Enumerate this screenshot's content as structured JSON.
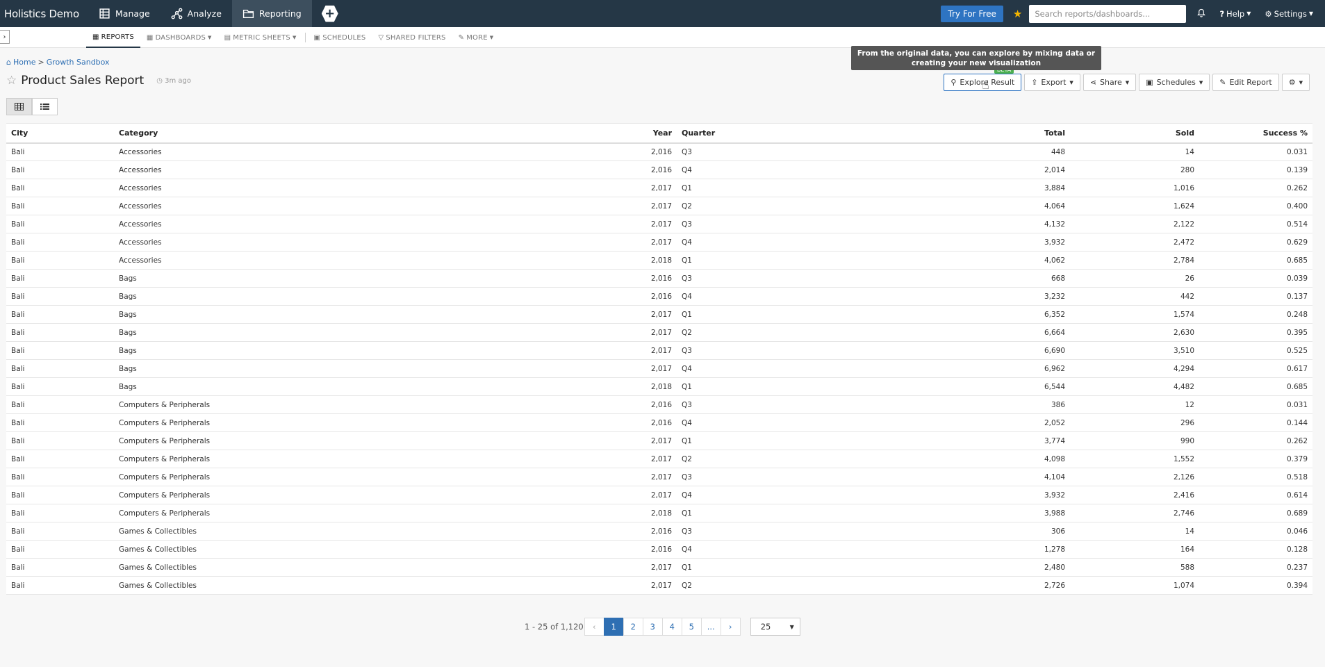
{
  "topbar": {
    "brand": "Holistics Demo",
    "nav": [
      {
        "label": "Manage",
        "icon": "manage-icon"
      },
      {
        "label": "Analyze",
        "icon": "analyze-icon"
      },
      {
        "label": "Reporting",
        "icon": "folder-icon",
        "active": true
      }
    ],
    "try_label": "Try For Free",
    "search_placeholder": "Search reports/dashboards...",
    "help_label": "Help",
    "settings_label": "Settings"
  },
  "subnav": {
    "items": [
      {
        "label": "REPORTS",
        "active": true
      },
      {
        "label": "DASHBOARDS"
      },
      {
        "label": "METRIC SHEETS"
      },
      {
        "label": "SCHEDULES"
      },
      {
        "label": "SHARED FILTERS"
      },
      {
        "label": "MORE"
      }
    ]
  },
  "breadcrumb": {
    "home": "Home",
    "sep": ">",
    "folder": "Growth Sandbox"
  },
  "report": {
    "title": "Product Sales Report",
    "time_ago": "3m ago"
  },
  "tooltip": "From the original data, you can explore by mixing data or creating your new visualization",
  "actions": {
    "explore": "Explore Result",
    "beta": "BETA",
    "export": "Export",
    "share": "Share",
    "schedules": "Schedules",
    "edit": "Edit Report"
  },
  "table": {
    "headers": [
      "City",
      "Category",
      "Year",
      "Quarter",
      "Total",
      "Sold",
      "Success %"
    ],
    "rows": [
      [
        "Bali",
        "Accessories",
        "2,016",
        "Q3",
        "448",
        "14",
        "0.031"
      ],
      [
        "Bali",
        "Accessories",
        "2,016",
        "Q4",
        "2,014",
        "280",
        "0.139"
      ],
      [
        "Bali",
        "Accessories",
        "2,017",
        "Q1",
        "3,884",
        "1,016",
        "0.262"
      ],
      [
        "Bali",
        "Accessories",
        "2,017",
        "Q2",
        "4,064",
        "1,624",
        "0.400"
      ],
      [
        "Bali",
        "Accessories",
        "2,017",
        "Q3",
        "4,132",
        "2,122",
        "0.514"
      ],
      [
        "Bali",
        "Accessories",
        "2,017",
        "Q4",
        "3,932",
        "2,472",
        "0.629"
      ],
      [
        "Bali",
        "Accessories",
        "2,018",
        "Q1",
        "4,062",
        "2,784",
        "0.685"
      ],
      [
        "Bali",
        "Bags",
        "2,016",
        "Q3",
        "668",
        "26",
        "0.039"
      ],
      [
        "Bali",
        "Bags",
        "2,016",
        "Q4",
        "3,232",
        "442",
        "0.137"
      ],
      [
        "Bali",
        "Bags",
        "2,017",
        "Q1",
        "6,352",
        "1,574",
        "0.248"
      ],
      [
        "Bali",
        "Bags",
        "2,017",
        "Q2",
        "6,664",
        "2,630",
        "0.395"
      ],
      [
        "Bali",
        "Bags",
        "2,017",
        "Q3",
        "6,690",
        "3,510",
        "0.525"
      ],
      [
        "Bali",
        "Bags",
        "2,017",
        "Q4",
        "6,962",
        "4,294",
        "0.617"
      ],
      [
        "Bali",
        "Bags",
        "2,018",
        "Q1",
        "6,544",
        "4,482",
        "0.685"
      ],
      [
        "Bali",
        "Computers & Peripherals",
        "2,016",
        "Q3",
        "386",
        "12",
        "0.031"
      ],
      [
        "Bali",
        "Computers & Peripherals",
        "2,016",
        "Q4",
        "2,052",
        "296",
        "0.144"
      ],
      [
        "Bali",
        "Computers & Peripherals",
        "2,017",
        "Q1",
        "3,774",
        "990",
        "0.262"
      ],
      [
        "Bali",
        "Computers & Peripherals",
        "2,017",
        "Q2",
        "4,098",
        "1,552",
        "0.379"
      ],
      [
        "Bali",
        "Computers & Peripherals",
        "2,017",
        "Q3",
        "4,104",
        "2,126",
        "0.518"
      ],
      [
        "Bali",
        "Computers & Peripherals",
        "2,017",
        "Q4",
        "3,932",
        "2,416",
        "0.614"
      ],
      [
        "Bali",
        "Computers & Peripherals",
        "2,018",
        "Q1",
        "3,988",
        "2,746",
        "0.689"
      ],
      [
        "Bali",
        "Games & Collectibles",
        "2,016",
        "Q3",
        "306",
        "14",
        "0.046"
      ],
      [
        "Bali",
        "Games & Collectibles",
        "2,016",
        "Q4",
        "1,278",
        "164",
        "0.128"
      ],
      [
        "Bali",
        "Games & Collectibles",
        "2,017",
        "Q1",
        "2,480",
        "588",
        "0.237"
      ],
      [
        "Bali",
        "Games & Collectibles",
        "2,017",
        "Q2",
        "2,726",
        "1,074",
        "0.394"
      ]
    ]
  },
  "pagination": {
    "info": "1 - 25 of 1,120",
    "prev": "‹",
    "pages": [
      "1",
      "2",
      "3",
      "4",
      "5",
      "..."
    ],
    "next": "›",
    "page_size": "25"
  }
}
